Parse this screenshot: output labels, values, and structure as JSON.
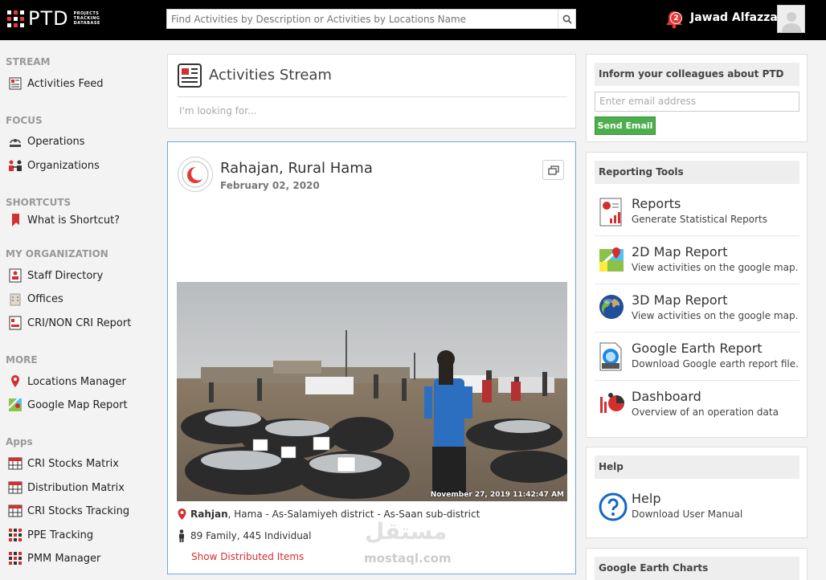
{
  "header": {
    "logo_text": "PTD",
    "logo_subtitle": "PROJECTS TRACKING DATABASE",
    "search_placeholder": "Find Activities by Description or Activities by Locations Name",
    "notification_count": "2",
    "user_name": "Jawad Alfazzaa"
  },
  "sidebar": {
    "sections": [
      {
        "title": "STREAM",
        "items": [
          {
            "label": "Activities Feed",
            "icon": "newspaper-icon"
          }
        ]
      },
      {
        "title": "FOCUS",
        "items": [
          {
            "label": "Operations",
            "icon": "unhcr-icon"
          },
          {
            "label": "Organizations",
            "icon": "people-icon"
          }
        ]
      },
      {
        "title": "SHORTCUTS",
        "items": [
          {
            "label": "What is Shortcut?",
            "icon": "bookmark-icon"
          }
        ]
      },
      {
        "title": "MY ORGANIZATION",
        "items": [
          {
            "label": "Staff Directory",
            "icon": "directory-icon"
          },
          {
            "label": "Offices",
            "icon": "building-icon"
          },
          {
            "label": "CRI/NON CRI Report",
            "icon": "report-icon"
          }
        ]
      },
      {
        "title": "MORE",
        "items": [
          {
            "label": "Locations Manager",
            "icon": "location-pin-icon"
          },
          {
            "label": "Google Map Report",
            "icon": "map-icon"
          }
        ]
      },
      {
        "title": "Apps",
        "items": [
          {
            "label": "CRI Stocks Matrix",
            "icon": "matrix-icon"
          },
          {
            "label": "Distribution Matrix",
            "icon": "matrix-icon"
          },
          {
            "label": "CRI Stocks Tracking",
            "icon": "matrix-icon"
          },
          {
            "label": "PPE Tracking",
            "icon": "grid-icon"
          },
          {
            "label": "PMM Manager",
            "icon": "grid-icon"
          }
        ]
      }
    ]
  },
  "stream": {
    "title": "Activities Stream",
    "filter_placeholder": "I'm looking for..."
  },
  "activity": {
    "title": "Rahajan, Rural Hama",
    "date": "February 02, 2020",
    "photo_timestamp": "November 27, 2019 11:42:47 AM",
    "location_bold": "Rahjan",
    "location_rest": ", Hama - As-Salamiyeh district - As-Saan sub-district",
    "beneficiaries": "89 Family, 445 Individual",
    "show_items": "Show Distributed Items"
  },
  "inform": {
    "title": "Inform your colleagues about PTD",
    "email_placeholder": "Enter email address",
    "send_label": "Send Email"
  },
  "reporting": {
    "title": "Reporting Tools",
    "tools": [
      {
        "title": "Reports",
        "subtitle": "Generate Statistical Reports",
        "icon": "report-chart-icon"
      },
      {
        "title": "2D Map Report",
        "subtitle": "View activities on the google map.",
        "icon": "map-2d-icon"
      },
      {
        "title": "3D Map Report",
        "subtitle": "View activities on the google map.",
        "icon": "globe-icon"
      },
      {
        "title": "Google Earth Report",
        "subtitle": "Download Google earth report file.",
        "icon": "kmz-file-icon"
      },
      {
        "title": "Dashboard",
        "subtitle": "Overview of an operation data",
        "icon": "dashboard-icon"
      }
    ]
  },
  "help": {
    "title": "Help",
    "item_title": "Help",
    "item_subtitle": "Download User Manual"
  },
  "charts": {
    "title": "Google Earth Charts"
  },
  "watermark": {
    "arabic": "مستقل",
    "latin": "mostaql.com"
  },
  "colors": {
    "accent_red": "#e53935",
    "send_green": "#4cae4c",
    "card_border": "#6aa9e6"
  }
}
